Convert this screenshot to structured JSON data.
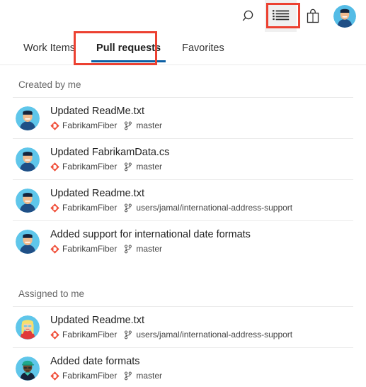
{
  "topbar": {
    "icons": [
      {
        "name": "search-icon",
        "label": "Search"
      },
      {
        "name": "work-items-icon",
        "label": "Work items"
      },
      {
        "name": "marketplace-bag-icon",
        "label": "Marketplace"
      },
      {
        "name": "user-avatar",
        "label": "User profile"
      }
    ],
    "highlight_color": "#EC4131",
    "active_icon": "work-items-icon"
  },
  "tabs": [
    {
      "label": "Work Items",
      "selected": false
    },
    {
      "label": "Pull requests",
      "selected": true
    },
    {
      "label": "Favorites",
      "selected": false
    }
  ],
  "accent_color": "#0B5FA4",
  "sections": [
    {
      "header": "Created by me",
      "items": [
        {
          "title": "Updated ReadMe.txt",
          "repo": "FabrikamFiber",
          "branch": "master",
          "avatar": "avatar-man-blue"
        },
        {
          "title": "Updated FabrikamData.cs",
          "repo": "FabrikamFiber",
          "branch": "master",
          "avatar": "avatar-man-blue"
        },
        {
          "title": "Updated Readme.txt",
          "repo": "FabrikamFiber",
          "branch": "users/jamal/international-address-support",
          "avatar": "avatar-man-blue"
        },
        {
          "title": "Added support for international date formats",
          "repo": "FabrikamFiber",
          "branch": "master",
          "avatar": "avatar-man-blue"
        }
      ]
    },
    {
      "header": "Assigned to me",
      "items": [
        {
          "title": "Updated Readme.txt",
          "repo": "FabrikamFiber",
          "branch": "users/jamal/international-address-support",
          "avatar": "avatar-woman-blonde"
        },
        {
          "title": "Added date formats",
          "repo": "FabrikamFiber",
          "branch": "master",
          "avatar": "avatar-person-greencap"
        }
      ]
    }
  ]
}
